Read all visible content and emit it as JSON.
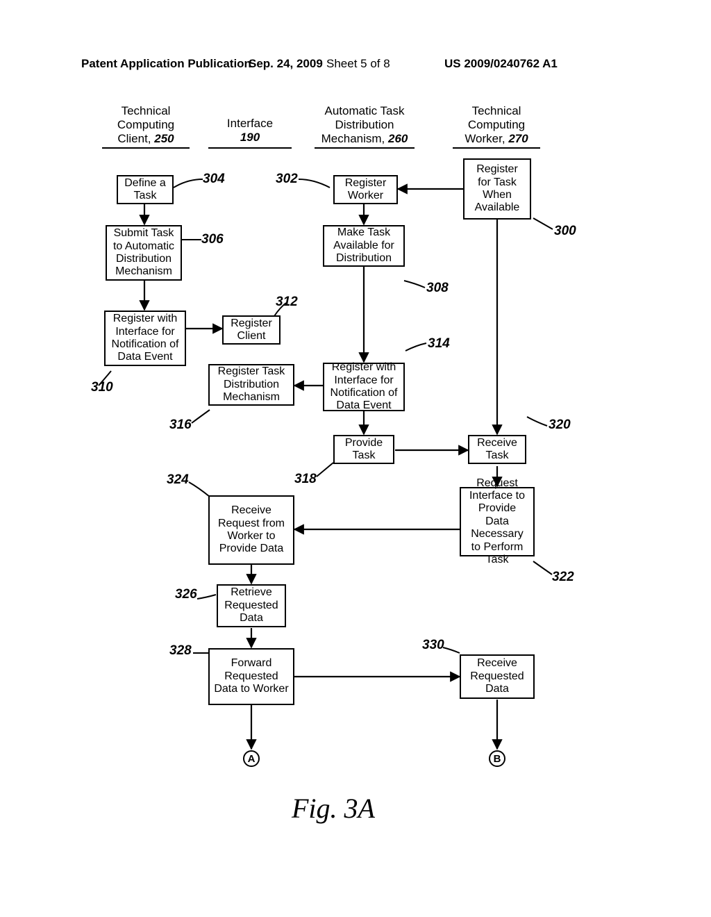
{
  "header": {
    "publication": "Patent Application Publication",
    "date": "Sep. 24, 2009",
    "sheet": "Sheet 5 of 8",
    "number": "US 2009/0240762 A1"
  },
  "lanes": {
    "client": {
      "title": "Technical\nComputing\nClient,",
      "num": "250"
    },
    "iface": {
      "title": "Interface",
      "num": "190"
    },
    "mech": {
      "title": "Automatic Task\nDistribution\nMechanism,",
      "num": "260"
    },
    "worker": {
      "title": "Technical\nComputing\nWorker,",
      "num": "270"
    }
  },
  "boxes": {
    "b300": "Register for Task When Available",
    "b302": "Register Worker",
    "b304": "Define a Task",
    "b306": "Submit Task to Automatic Distribution Mechanism",
    "b308": "Make Task Available for Distribution",
    "b310": "Register with Interface for Notification of Data Event",
    "b312": "Register Client",
    "b314": "Register with Interface for Notification of Data Event",
    "b316": "Register Task Distribution Mechanism",
    "b318": "Provide Task",
    "b320": "Receive Task",
    "b322": "Request Interface to Provide Data Necessary to Perform Task",
    "b324": "Receive Request from Worker to Provide Data",
    "b326": "Retrieve Requested Data",
    "b328": "Forward Requested Data to Worker",
    "b330": "Receive Requested Data"
  },
  "refs": {
    "r300": "300",
    "r302": "302",
    "r304": "304",
    "r306": "306",
    "r308": "308",
    "r310": "310",
    "r312": "312",
    "r314": "314",
    "r316": "316",
    "r318": "318",
    "r320": "320",
    "r322": "322",
    "r324": "324",
    "r326": "326",
    "r328": "328",
    "r330": "330"
  },
  "connectors": {
    "A": "A",
    "B": "B"
  },
  "figure": "Fig. 3A"
}
